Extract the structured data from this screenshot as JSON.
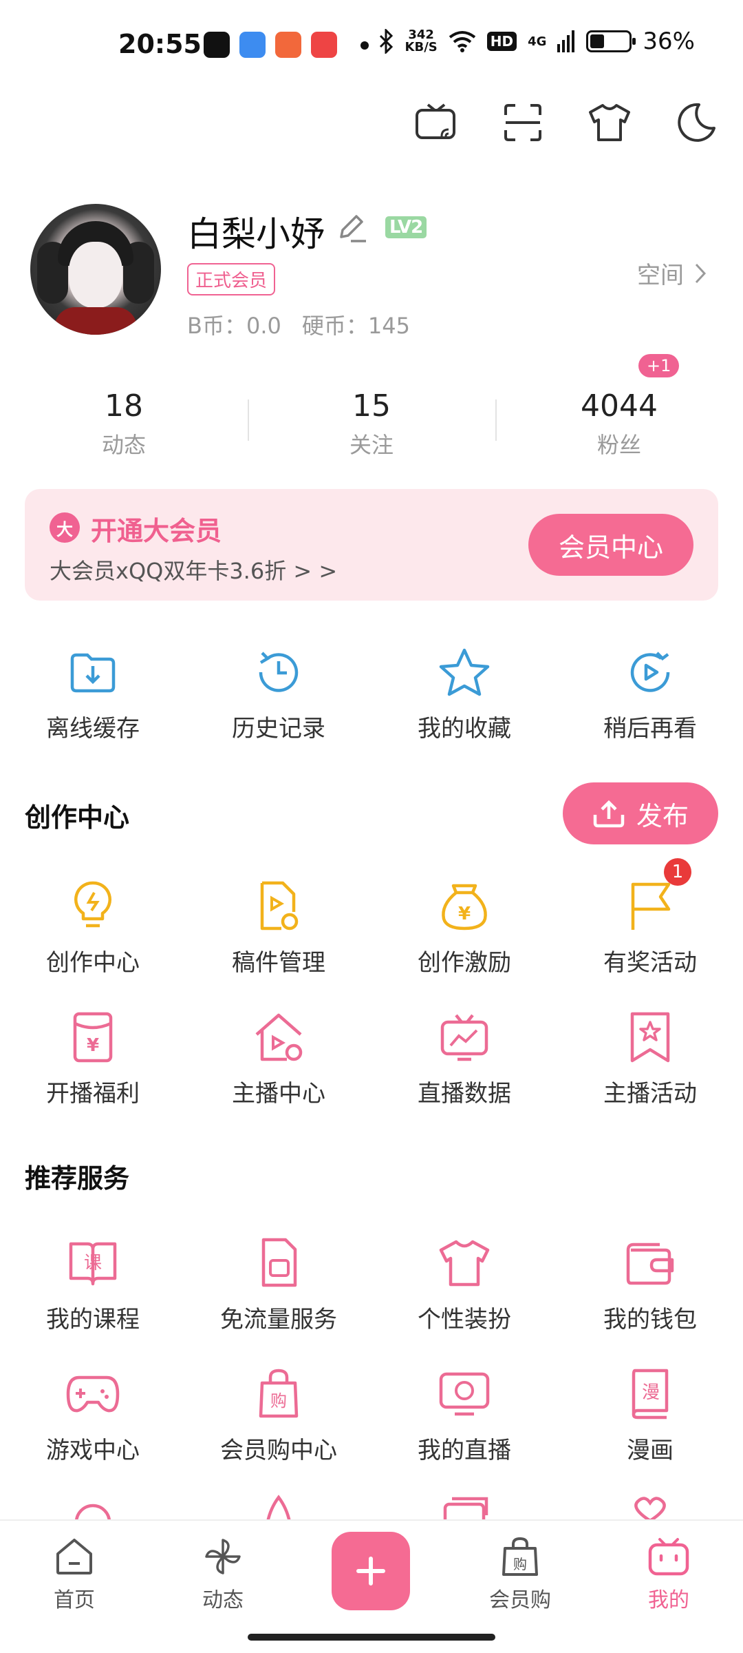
{
  "status": {
    "time": "20:55",
    "speed_value": "342",
    "speed_unit": "KB/S",
    "hd": "HD",
    "net": "4G",
    "battery_pct": "36%",
    "battery_level": 0.36
  },
  "profile": {
    "username": "白梨小妤",
    "level": "LV2",
    "vip_tag": "正式会员",
    "bcoin": "B币：0.0",
    "coin": "硬币：145",
    "space_label": "空间"
  },
  "stats": [
    {
      "value": "18",
      "label": "动态"
    },
    {
      "value": "15",
      "label": "关注"
    },
    {
      "value": "4044",
      "label": "粉丝"
    }
  ],
  "fans_new_badge": "+1",
  "vip_banner": {
    "badge": "大",
    "title": "开通大会员",
    "subtitle": "大会员xQQ双年卡3.6折 > >",
    "button": "会员中心"
  },
  "quick_actions": [
    {
      "label": "离线缓存",
      "icon": "download-folder-icon"
    },
    {
      "label": "历史记录",
      "icon": "history-icon"
    },
    {
      "label": "我的收藏",
      "icon": "star-icon"
    },
    {
      "label": "稍后再看",
      "icon": "watch-later-icon"
    }
  ],
  "creation": {
    "title": "创作中心",
    "publish": "发布",
    "row1": [
      {
        "label": "创作中心",
        "icon": "lightbulb-icon"
      },
      {
        "label": "稿件管理",
        "icon": "manuscript-icon"
      },
      {
        "label": "创作激励",
        "icon": "money-bag-icon"
      },
      {
        "label": "有奖活动",
        "icon": "flag-icon",
        "badge": "1"
      }
    ],
    "row2": [
      {
        "label": "开播福利",
        "icon": "red-envelope-icon"
      },
      {
        "label": "主播中心",
        "icon": "streamer-home-icon"
      },
      {
        "label": "直播数据",
        "icon": "live-data-icon"
      },
      {
        "label": "主播活动",
        "icon": "bookmark-star-icon"
      }
    ]
  },
  "services": {
    "title": "推荐服务",
    "row1": [
      {
        "label": "我的课程",
        "icon": "course-book-icon",
        "glyph": "课"
      },
      {
        "label": "免流量服务",
        "icon": "sim-card-icon"
      },
      {
        "label": "个性装扮",
        "icon": "tshirt-icon"
      },
      {
        "label": "我的钱包",
        "icon": "wallet-icon"
      }
    ],
    "row2": [
      {
        "label": "游戏中心",
        "icon": "gamepad-icon"
      },
      {
        "label": "会员购中心",
        "icon": "shopping-bag-icon",
        "glyph": "购"
      },
      {
        "label": "我的直播",
        "icon": "tv-icon"
      },
      {
        "label": "漫画",
        "icon": "comic-book-icon",
        "glyph": "漫"
      }
    ]
  },
  "bottom_nav": [
    {
      "label": "首页",
      "icon": "home-icon"
    },
    {
      "label": "动态",
      "icon": "pinwheel-icon"
    },
    {
      "label": "会员购",
      "icon": "shopping-bag-icon",
      "glyph": "购"
    },
    {
      "label": "我的",
      "icon": "tv-mascot-icon",
      "active": true
    }
  ],
  "colors": {
    "accent": "#F06292",
    "blue": "#3B9BD6",
    "yellow": "#F2B21B"
  }
}
